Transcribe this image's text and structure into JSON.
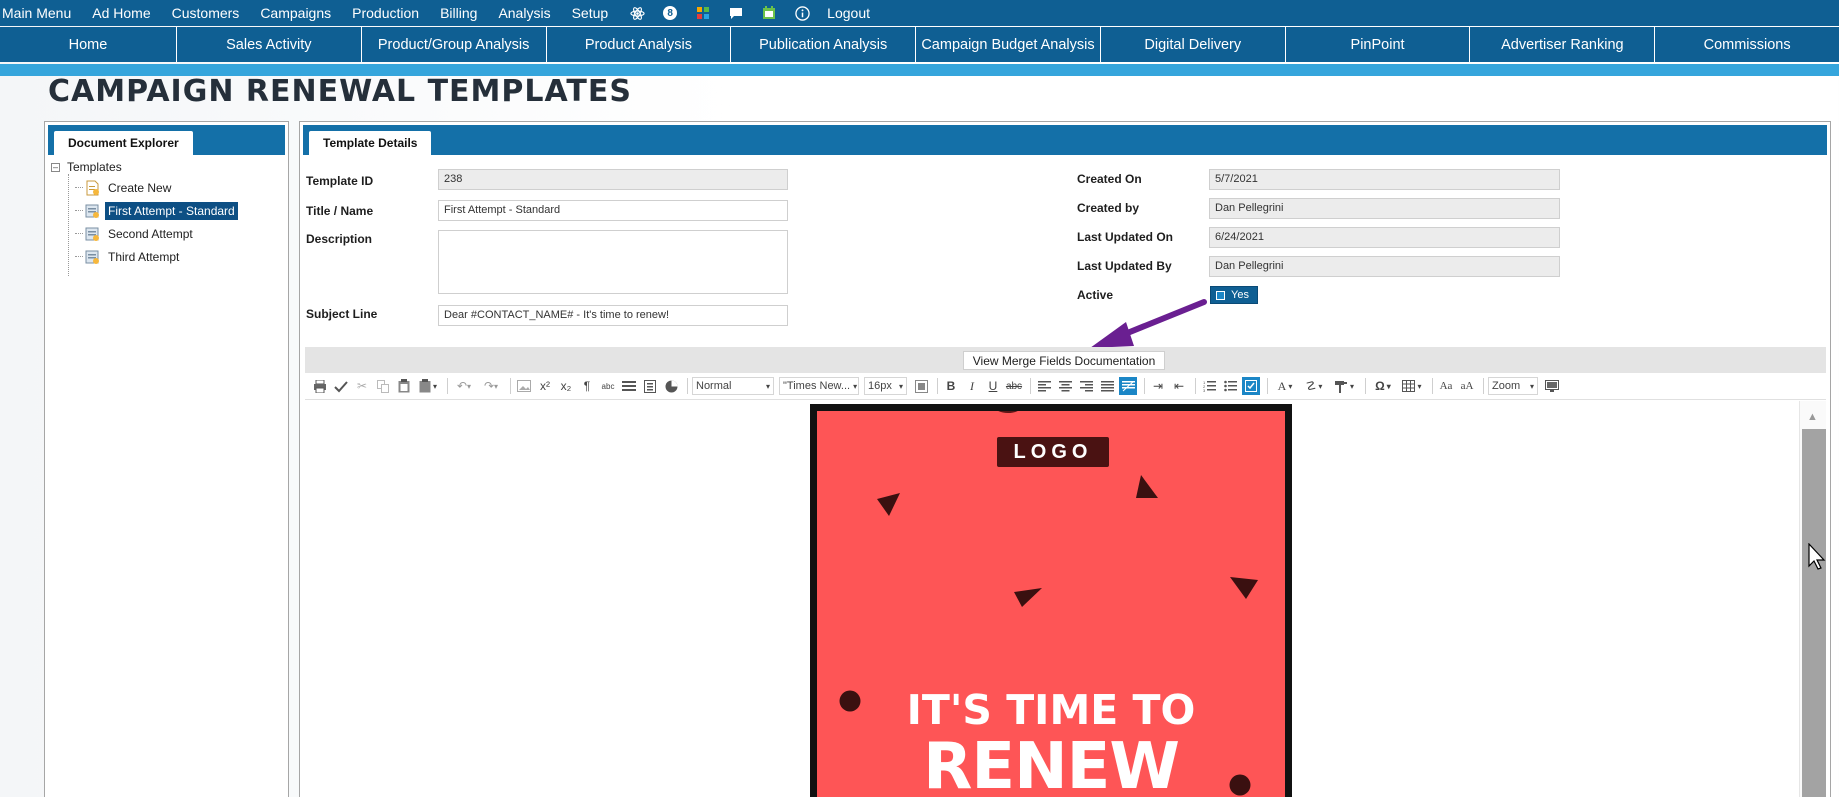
{
  "top_menu": [
    "Main Menu",
    "Ad Home",
    "Customers",
    "Campaigns",
    "Production",
    "Billing",
    "Analysis",
    "Setup"
  ],
  "top_menu_badge": "8",
  "logout_label": "Logout",
  "nav": [
    "Home",
    "Sales Activity",
    "Product/Group Analysis",
    "Product Analysis",
    "Publication Analysis",
    "Campaign Budget Analysis",
    "Digital Delivery",
    "PinPoint",
    "Advertiser Ranking",
    "Commissions"
  ],
  "page_title": "CAMPAIGN RENEWAL TEMPLATES",
  "explorer": {
    "tab": "Document Explorer",
    "root": "Templates",
    "items": [
      "Create New",
      "First Attempt - Standard",
      "Second Attempt",
      "Third Attempt"
    ]
  },
  "details": {
    "tab": "Template Details",
    "template_id_label": "Template ID",
    "template_id": "238",
    "title_label": "Title / Name",
    "title": "First Attempt - Standard",
    "description_label": "Description",
    "subject_label": "Subject Line",
    "subject": "Dear #CONTACT_NAME# - It's time to renew!",
    "created_on_label": "Created On",
    "created_on": "5/7/2021",
    "created_by_label": "Created by",
    "created_by": "Dan Pellegrini",
    "updated_on_label": "Last Updated On",
    "updated_on": "6/24/2021",
    "updated_by_label": "Last Updated By",
    "updated_by": "Dan Pellegrini",
    "active_label": "Active",
    "active_value": "Yes"
  },
  "merge_button": "View Merge Fields Documentation",
  "toolbar": {
    "format": "Normal",
    "font": "\"Times New...",
    "size": "16px",
    "zoom": "Zoom"
  },
  "banner": {
    "logo": "LOGO",
    "line1": "IT'S TIME TO",
    "line2": "RENEW"
  },
  "colors": {
    "nav_bg": "#0f5f93",
    "accent_stripe": "#35a5dc",
    "banner_bg": "#fe5556",
    "arrow": "#6a1f91"
  }
}
